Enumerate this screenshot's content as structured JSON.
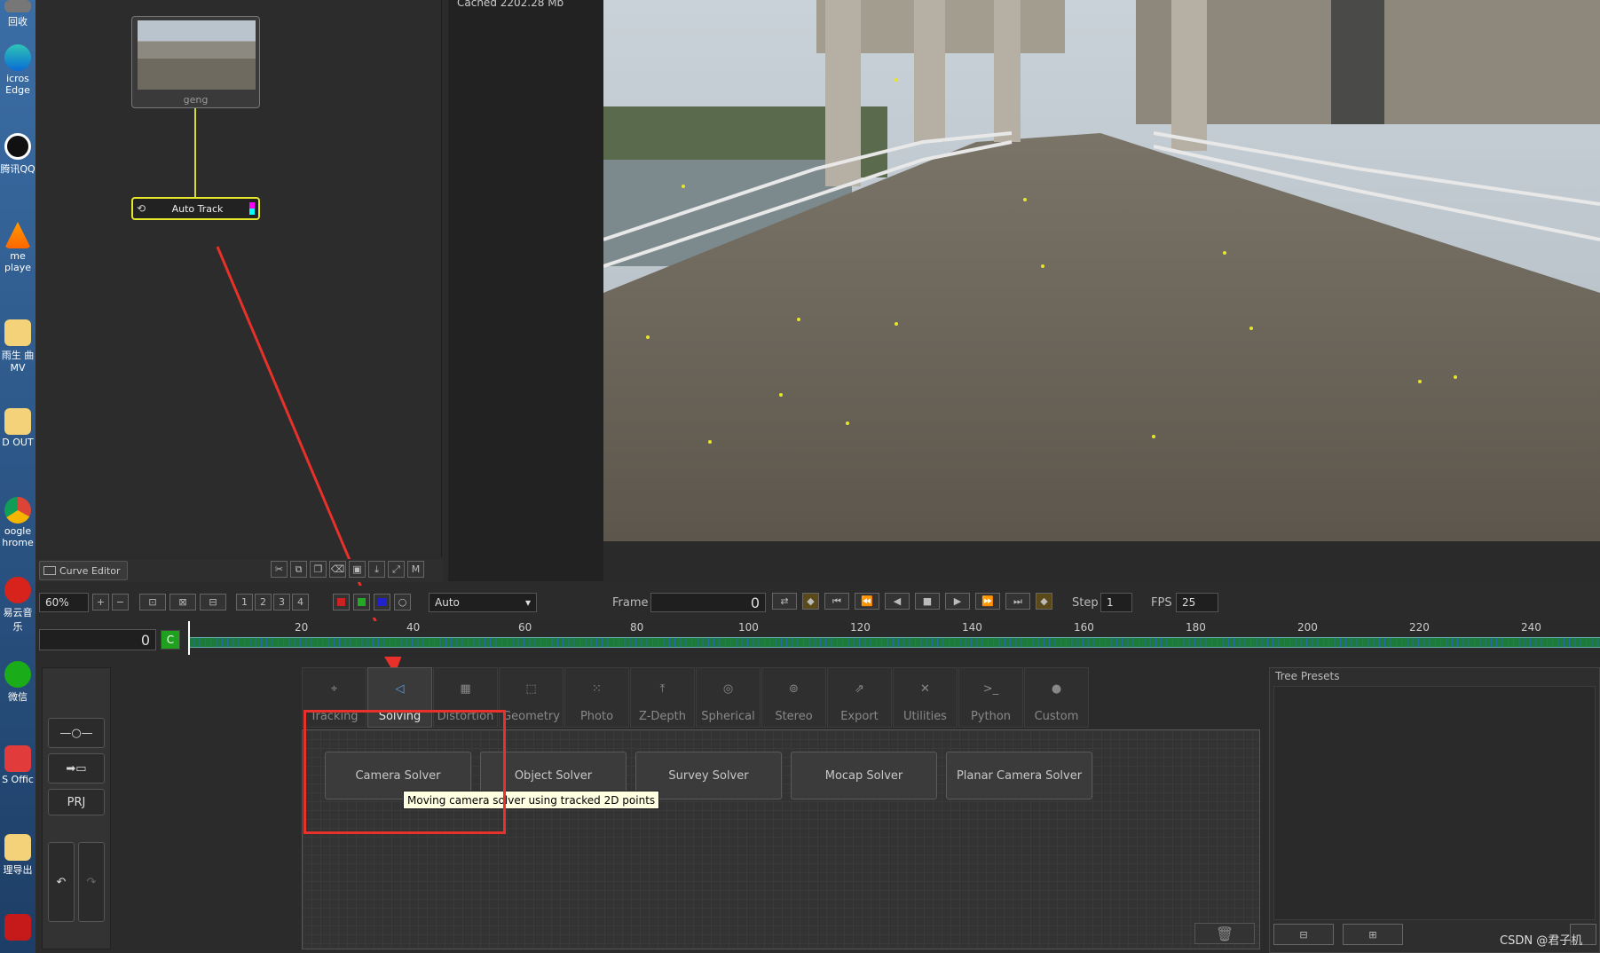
{
  "desktop": {
    "icons": [
      {
        "label": "回收",
        "icon": "recycle-bin-icon"
      },
      {
        "label": "icros Edge",
        "icon": "edge-icon"
      },
      {
        "label": "腾讯QQ",
        "icon": "qq-icon"
      },
      {
        "label": "me playe",
        "icon": "vlc-icon"
      },
      {
        "label": "雨生 曲MV",
        "icon": "folder-icon"
      },
      {
        "label": "D OUT",
        "icon": "folder-icon"
      },
      {
        "label": "oogle hrome",
        "icon": "chrome-icon"
      },
      {
        "label": "易云音乐",
        "icon": "netease-music-icon"
      },
      {
        "label": "微信",
        "icon": "wechat-icon"
      },
      {
        "label": "S Offic",
        "icon": "wps-icon"
      },
      {
        "label": "理导出",
        "icon": "folder-icon"
      },
      {
        "label": "",
        "icon": "pdf-icon"
      }
    ]
  },
  "nodegraph": {
    "source_node_label": "geng",
    "track_node_label": "Auto Track",
    "curve_editor_label": "Curve Editor",
    "cached_text": "Cached 2202.28 Mb"
  },
  "toolbar": {
    "zoom": "60%",
    "view_nums": [
      "1",
      "2",
      "3",
      "4"
    ],
    "mode_select": "Auto",
    "frame_label": "Frame",
    "frame_value": "0",
    "step_label": "Step",
    "step_value": "1",
    "fps_label": "FPS",
    "fps_value": "25"
  },
  "timeline": {
    "current_frame": "0",
    "c_button": "C",
    "ticks": [
      "20",
      "40",
      "60",
      "80",
      "100",
      "120",
      "140",
      "160",
      "180",
      "200",
      "220",
      "240"
    ]
  },
  "tabs": [
    {
      "label": "Tracking",
      "icon": "tracking-icon"
    },
    {
      "label": "Solving",
      "icon": "solving-icon"
    },
    {
      "label": "Distortion",
      "icon": "distortion-icon"
    },
    {
      "label": "Geometry",
      "icon": "geometry-icon"
    },
    {
      "label": "Photo",
      "icon": "photo-icon"
    },
    {
      "label": "Z-Depth",
      "icon": "zdepth-icon"
    },
    {
      "label": "Spherical",
      "icon": "spherical-icon"
    },
    {
      "label": "Stereo",
      "icon": "stereo-icon"
    },
    {
      "label": "Export",
      "icon": "export-icon"
    },
    {
      "label": "Utilities",
      "icon": "utilities-icon"
    },
    {
      "label": "Python",
      "icon": "python-icon"
    },
    {
      "label": "Custom",
      "icon": "custom-icon"
    }
  ],
  "active_tab": "Solving",
  "solvers": [
    "Camera Solver",
    "Object Solver",
    "Survey Solver",
    "Mocap Solver",
    "Planar Camera Solver"
  ],
  "tooltip": "Moving camera solver using tracked 2D points",
  "presets": {
    "title": "Tree Presets"
  },
  "watermark": "CSDN @君子机",
  "colors": {
    "annotation_red": "#e8312a",
    "node_yellow": "#e6e62a",
    "track_green": "#2e8b57"
  }
}
